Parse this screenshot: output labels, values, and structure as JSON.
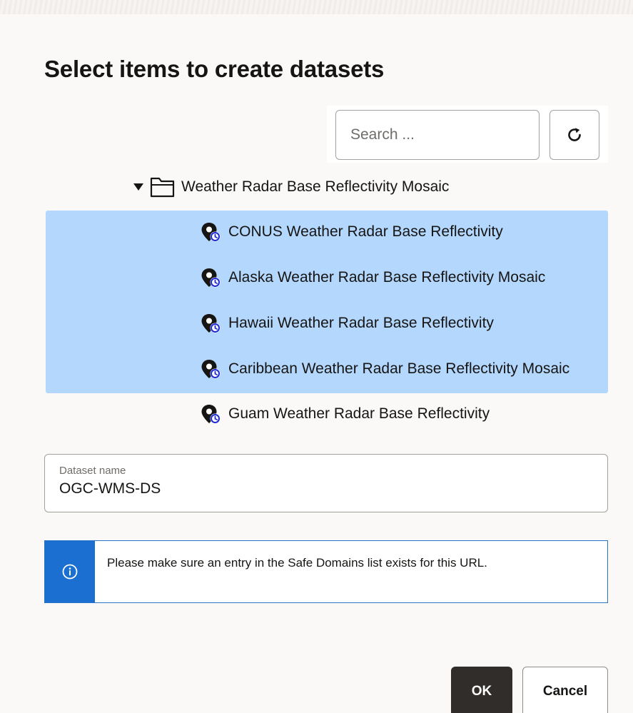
{
  "dialog": {
    "title": "Select items to create datasets"
  },
  "search": {
    "placeholder": "Search ...",
    "value": ""
  },
  "refresh": {
    "icon": "refresh-icon"
  },
  "tree": {
    "folder": {
      "label": "Weather Radar Base Reflectivity Mosaic",
      "expanded": true,
      "icon": "folder-icon"
    },
    "items": [
      {
        "label": "CONUS Weather Radar Base Reflectivity",
        "selected": true,
        "icon": "map-layer-time-icon"
      },
      {
        "label": "Alaska Weather Radar Base Reflectivity Mosaic",
        "selected": true,
        "icon": "map-layer-time-icon"
      },
      {
        "label": "Hawaii Weather Radar Base Reflectivity",
        "selected": true,
        "icon": "map-layer-time-icon"
      },
      {
        "label": "Caribbean Weather Radar Base Reflectivity Mosaic",
        "selected": true,
        "icon": "map-layer-time-icon"
      },
      {
        "label": "Guam Weather Radar Base Reflectivity",
        "selected": false,
        "icon": "map-layer-time-icon"
      }
    ]
  },
  "dataset_name": {
    "label": "Dataset name",
    "value": "OGC-WMS-DS"
  },
  "info": {
    "message": "Please make sure an entry in the Safe Domains list exists for this URL.",
    "icon": "info-icon"
  },
  "buttons": {
    "ok_label": "OK",
    "cancel_label": "Cancel"
  },
  "colors": {
    "selection": "#b3d7fd",
    "info_accent": "#1a6fd0",
    "primary_button": "#312d2a",
    "clock_badge": "#1f2bd6"
  }
}
